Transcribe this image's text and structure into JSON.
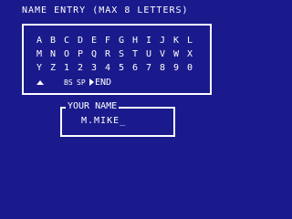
{
  "title": "NAME ENTRY (MAX 8 LETTERS)",
  "grid": {
    "rows": [
      [
        "A",
        "B",
        "C",
        "D",
        "E",
        "F",
        "G",
        "H",
        "I",
        "J",
        "K",
        "L"
      ],
      [
        "M",
        "N",
        "O",
        "P",
        "Q",
        "R",
        "S",
        "T",
        "U",
        "V",
        "W",
        "X"
      ],
      [
        "Y",
        "Z",
        "1",
        "2",
        "3",
        "4",
        "5",
        "6",
        "7",
        "8",
        "9",
        "0"
      ]
    ],
    "controls": {
      "caret": "^",
      "backspace": "BS",
      "space": "SP",
      "end": "END"
    }
  },
  "name_entry": {
    "label": "YOUR NAME",
    "value": "M.MIKE_"
  },
  "colors": {
    "background": "#1a1a8c",
    "foreground": "#ffffff"
  }
}
